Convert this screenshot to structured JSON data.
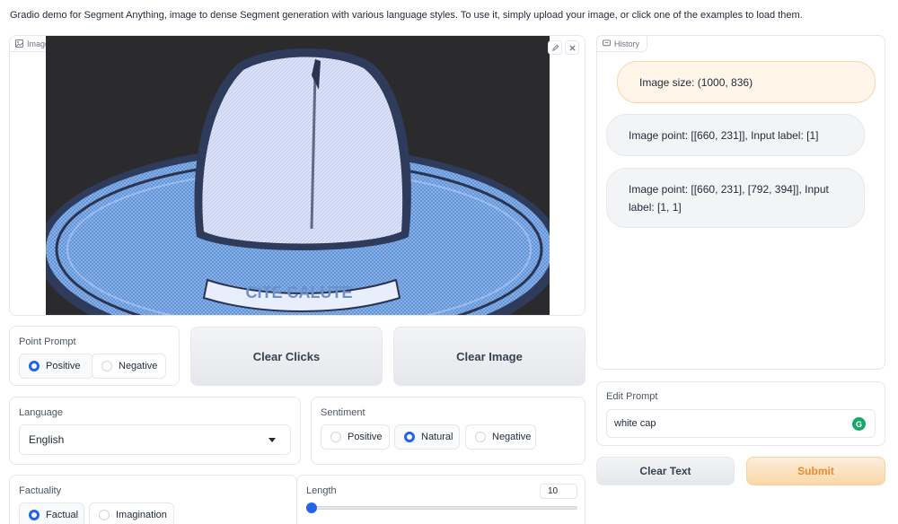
{
  "description": "Gradio demo for Segment Anything, image to dense Segment generation with various language styles. To use it, simply upload your image, or click one of the examples to load them.",
  "image_panel": {
    "label": "Image",
    "hat_text": "CITE CALUTE"
  },
  "history": {
    "label": "History",
    "messages": [
      {
        "role": "user",
        "text": "Image size: (1000, 836)"
      },
      {
        "role": "bot",
        "text": "Image point: [[660, 231]], Input label: [1]"
      },
      {
        "role": "bot",
        "text": "Image point: [[660, 231], [792, 394]], Input label: [1, 1]"
      }
    ]
  },
  "point_prompt": {
    "label": "Point Prompt",
    "options": [
      "Positive",
      "Negative"
    ],
    "selected": "Positive"
  },
  "buttons": {
    "clear_clicks": "Clear Clicks",
    "clear_image": "Clear Image",
    "clear_text": "Clear Text",
    "submit": "Submit"
  },
  "language": {
    "label": "Language",
    "value": "English"
  },
  "sentiment": {
    "label": "Sentiment",
    "options": [
      "Positive",
      "Natural",
      "Negative"
    ],
    "selected": "Natural"
  },
  "factuality": {
    "label": "Factuality",
    "options": [
      "Factual",
      "Imagination"
    ],
    "selected": "Factual"
  },
  "length": {
    "label": "Length",
    "value": "10"
  },
  "edit_prompt": {
    "label": "Edit Prompt",
    "value": "white cap",
    "grammarly_glyph": "G"
  },
  "colors": {
    "accent": "#2563eb",
    "primary_button": "#fad6a8",
    "primary_text": "#ea8a2d",
    "user_bubble": "#fff5e8"
  }
}
